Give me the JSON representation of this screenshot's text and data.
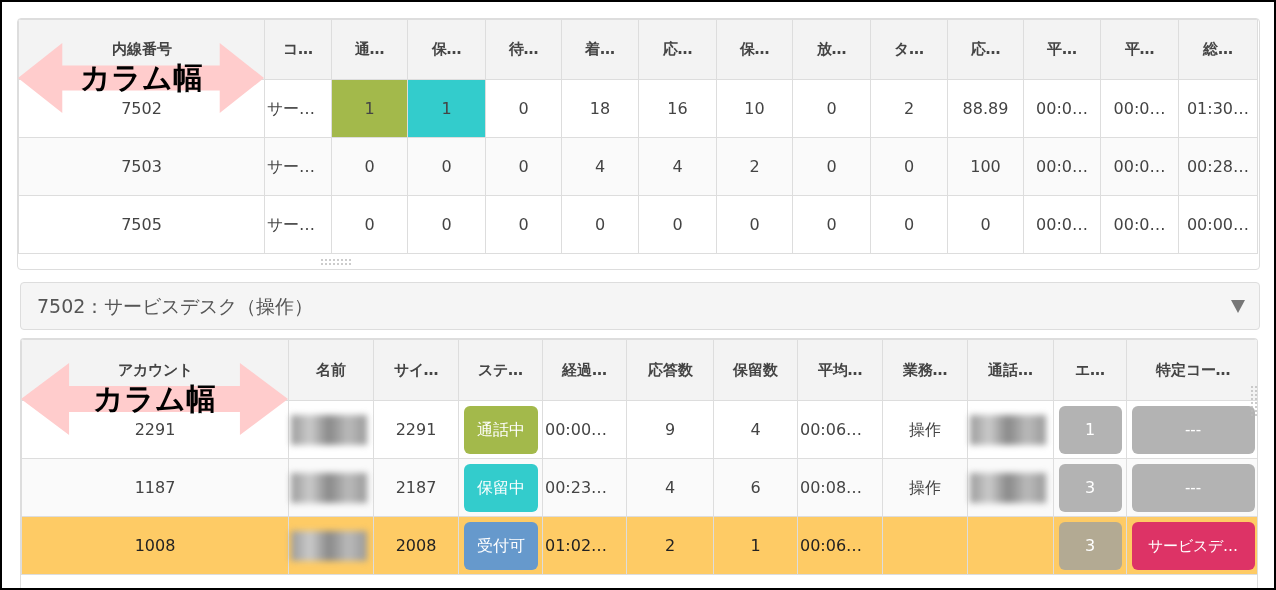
{
  "top_table": {
    "annotation": "カラム幅",
    "columns": [
      "内線番号",
      "コ…",
      "通…",
      "保…",
      "待…",
      "着…",
      "応…",
      "保…",
      "放…",
      "タ…",
      "応…",
      "平…",
      "平…",
      "総…"
    ],
    "rows": [
      {
        "cells": [
          {
            "text": "7502"
          },
          {
            "text": "サー…"
          },
          {
            "text": "1",
            "color": "#a3b94b"
          },
          {
            "text": "1",
            "color": "#33cccc"
          },
          {
            "text": "0"
          },
          {
            "text": "18"
          },
          {
            "text": "16"
          },
          {
            "text": "10"
          },
          {
            "text": "0"
          },
          {
            "text": "2"
          },
          {
            "text": "88.89"
          },
          {
            "text": "00:0…"
          },
          {
            "text": "00:0…"
          },
          {
            "text": "01:30…"
          }
        ]
      },
      {
        "cells": [
          {
            "text": "7503"
          },
          {
            "text": "サー…"
          },
          {
            "text": "0"
          },
          {
            "text": "0"
          },
          {
            "text": "0"
          },
          {
            "text": "4"
          },
          {
            "text": "4"
          },
          {
            "text": "2"
          },
          {
            "text": "0"
          },
          {
            "text": "0"
          },
          {
            "text": "100"
          },
          {
            "text": "00:0…"
          },
          {
            "text": "00:0…"
          },
          {
            "text": "00:28…"
          }
        ]
      },
      {
        "cells": [
          {
            "text": "7505"
          },
          {
            "text": "サー…"
          },
          {
            "text": "0"
          },
          {
            "text": "0"
          },
          {
            "text": "0"
          },
          {
            "text": "0"
          },
          {
            "text": "0"
          },
          {
            "text": "0"
          },
          {
            "text": "0"
          },
          {
            "text": "0"
          },
          {
            "text": "0"
          },
          {
            "text": "00:0…"
          },
          {
            "text": "00:0…"
          },
          {
            "text": "00:00…"
          }
        ]
      }
    ]
  },
  "queue_select": {
    "value": "7502：サービスデスク（操作）"
  },
  "agent_table": {
    "annotation": "カラム幅",
    "columns": [
      "アカウント",
      "名前",
      "サイ…",
      "ステ…",
      "経過…",
      "応答数",
      "保留数",
      "平均…",
      "業務…",
      "通話…",
      "エ…",
      "特定コー…"
    ],
    "rows": [
      {
        "highlighted": false,
        "account": "2291",
        "name_redacted": true,
        "site": "2291",
        "status": {
          "label": "通話中",
          "color": "#a3b94b"
        },
        "elapsed": "00:00…",
        "answered": "9",
        "held": "4",
        "average": "00:06…",
        "task": "操作",
        "call_redacted": true,
        "count": "1",
        "code": {
          "label": "---",
          "color": "#b3b3b3"
        }
      },
      {
        "highlighted": false,
        "account": "1187",
        "name_redacted": true,
        "site": "2187",
        "status": {
          "label": "保留中",
          "color": "#33cccc"
        },
        "elapsed": "00:23…",
        "answered": "4",
        "held": "6",
        "average": "00:08…",
        "task": "操作",
        "call_redacted": true,
        "count": "3",
        "code": {
          "label": "---",
          "color": "#b3b3b3"
        }
      },
      {
        "highlighted": true,
        "account": "1008",
        "name_redacted": true,
        "site": "2008",
        "status": {
          "label": "受付可",
          "color": "#6699cc"
        },
        "elapsed": "01:02…",
        "answered": "2",
        "held": "1",
        "average": "00:06…",
        "task": "",
        "call_redacted": false,
        "count": "3",
        "code": {
          "label": "サービスデ…",
          "color": "#dd3366"
        }
      }
    ]
  }
}
